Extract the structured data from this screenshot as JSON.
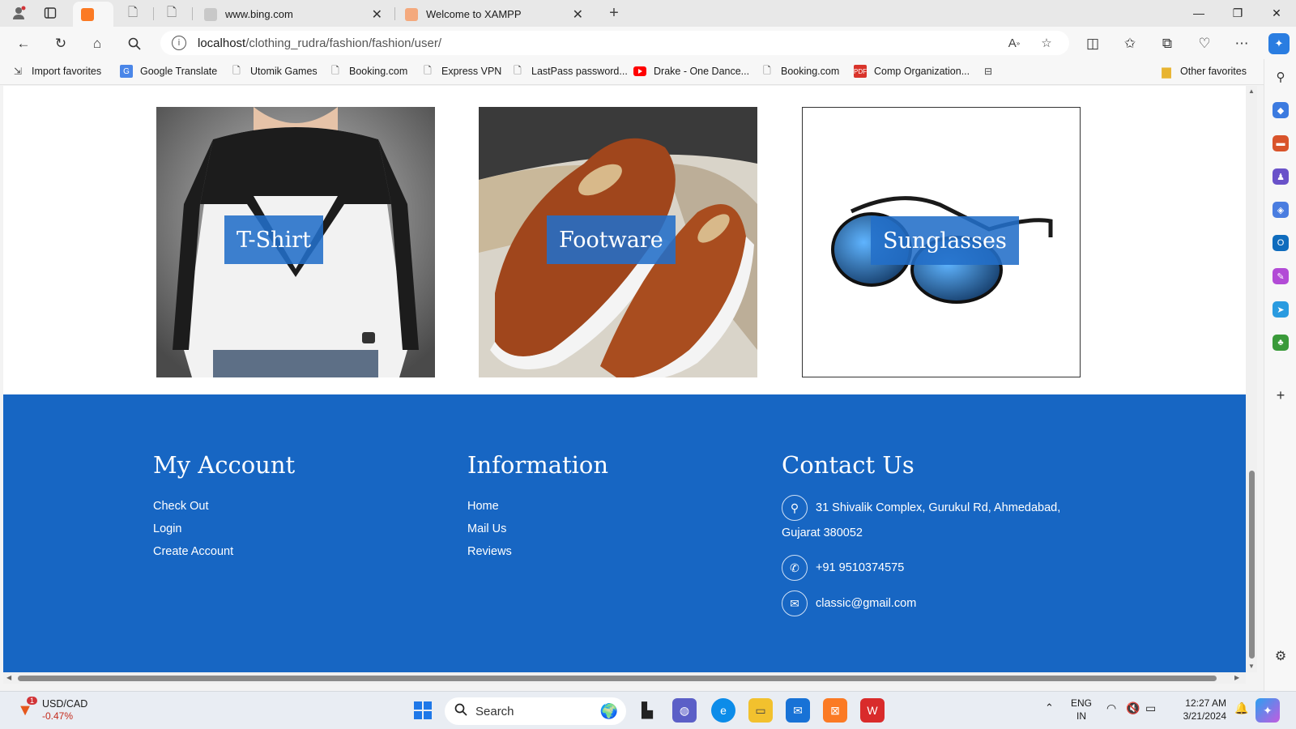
{
  "browser": {
    "tabs": [
      {
        "title": "",
        "active": true
      },
      {
        "title": "",
        "active": false
      },
      {
        "title": "",
        "active": false
      },
      {
        "title": "www.bing.com",
        "active": false
      },
      {
        "title": "Welcome to XAMPP",
        "active": false
      }
    ],
    "url_host": "localhost",
    "url_path": "/clothing_rudra/fashion/fashion/user/",
    "favorites": [
      "Import favorites",
      "Google Translate",
      "Utomik Games",
      "Booking.com",
      "Express VPN",
      "LastPass password...",
      "Drake - One Dance...",
      "Booking.com",
      "Comp Organization..."
    ],
    "other_favorites": "Other favorites"
  },
  "categories": [
    {
      "label": "T-Shirt"
    },
    {
      "label": "Footware"
    },
    {
      "label": "Sunglasses"
    }
  ],
  "footer": {
    "account": {
      "title": "My Account",
      "links": [
        "Check Out",
        "Login",
        "Create Account"
      ]
    },
    "information": {
      "title": "Information",
      "links": [
        "Home",
        "Mail Us",
        "Reviews"
      ]
    },
    "contact": {
      "title": "Contact Us",
      "address_line1": "31 Shivalik Complex, Gurukul Rd, Ahmedabad,",
      "address_line2": "Gujarat 380052",
      "phone": "+91 9510374575",
      "email": "classic@gmail.com"
    }
  },
  "taskbar": {
    "ticker_name": "USD/CAD",
    "ticker_change": "-0.47%",
    "ticker_badge": "1",
    "search_placeholder": "Search",
    "lang_line1": "ENG",
    "lang_line2": "IN",
    "time": "12:27 AM",
    "date": "3/21/2024"
  },
  "colors": {
    "footer_bg": "#1766c3",
    "label_bg": "#226ec8"
  }
}
